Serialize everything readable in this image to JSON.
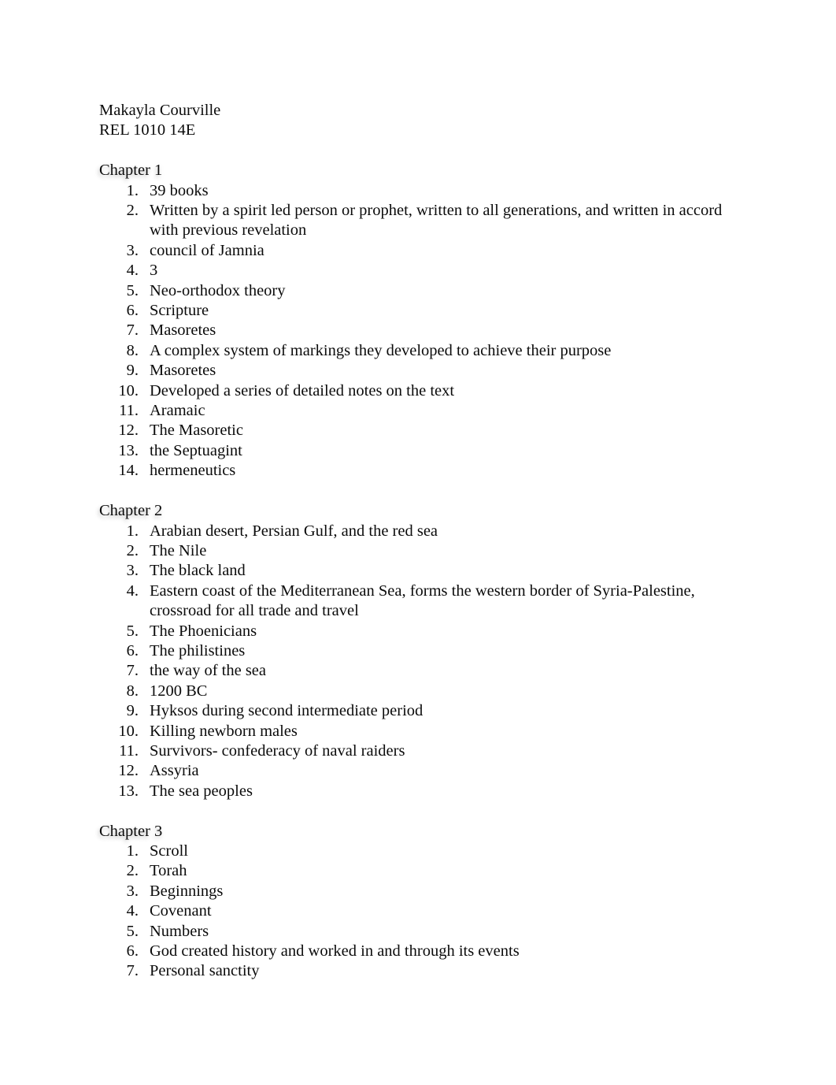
{
  "document": {
    "header": {
      "student_name": "Makayla Courville",
      "course": "REL 1010 14E"
    },
    "sections": [
      {
        "heading": "Chapter 1",
        "items": [
          "39 books",
          "Written by a spirit led person or prophet, written to all generations, and written in accord with previous revelation",
          "council of Jamnia",
          "3",
          "Neo-orthodox theory",
          "Scripture",
          "Masoretes",
          "A complex system of markings they developed to achieve their purpose",
          "Masoretes",
          "Developed a series of detailed notes on the text",
          "Aramaic",
          "The Masoretic",
          "the Septuagint",
          "hermeneutics"
        ]
      },
      {
        "heading": "Chapter 2",
        "items": [
          "Arabian desert, Persian Gulf, and the red sea",
          "The Nile",
          "The black land",
          "Eastern coast of the Mediterranean Sea, forms the western border of Syria-Palestine, crossroad for all trade and travel",
          "The Phoenicians",
          "The philistines",
          "the way of the sea",
          "1200 BC",
          "Hyksos during second intermediate period",
          "Killing newborn males",
          "Survivors- confederacy of naval raiders",
          "Assyria",
          "The sea peoples"
        ]
      },
      {
        "heading": "Chapter 3",
        "items": [
          "Scroll",
          "Torah",
          "Beginnings",
          "Covenant",
          "Numbers",
          "God created history and worked in and through its events",
          "Personal sanctity"
        ]
      }
    ]
  },
  "colors": {
    "page_background": "#ffffff",
    "text": "#0b0b0b",
    "heading_halo": "#787878"
  }
}
